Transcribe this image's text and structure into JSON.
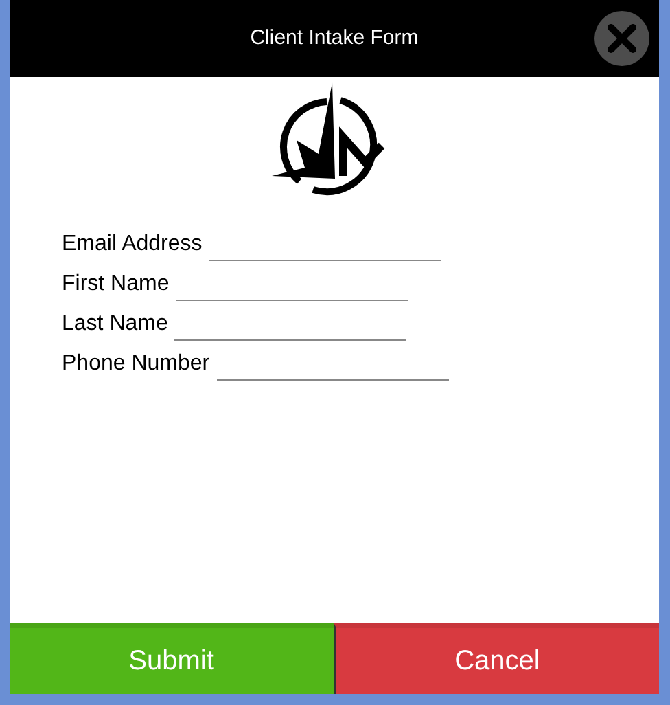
{
  "window": {
    "title": "Client Intake Form"
  },
  "fields": [
    {
      "label": "Email Address"
    },
    {
      "label": "First Name"
    },
    {
      "label": "Last Name"
    },
    {
      "label": "Phone Number"
    }
  ],
  "buttons": [
    {
      "label": "Submit",
      "kind": "submit"
    },
    {
      "label": "Cancel",
      "kind": "cancel"
    }
  ]
}
